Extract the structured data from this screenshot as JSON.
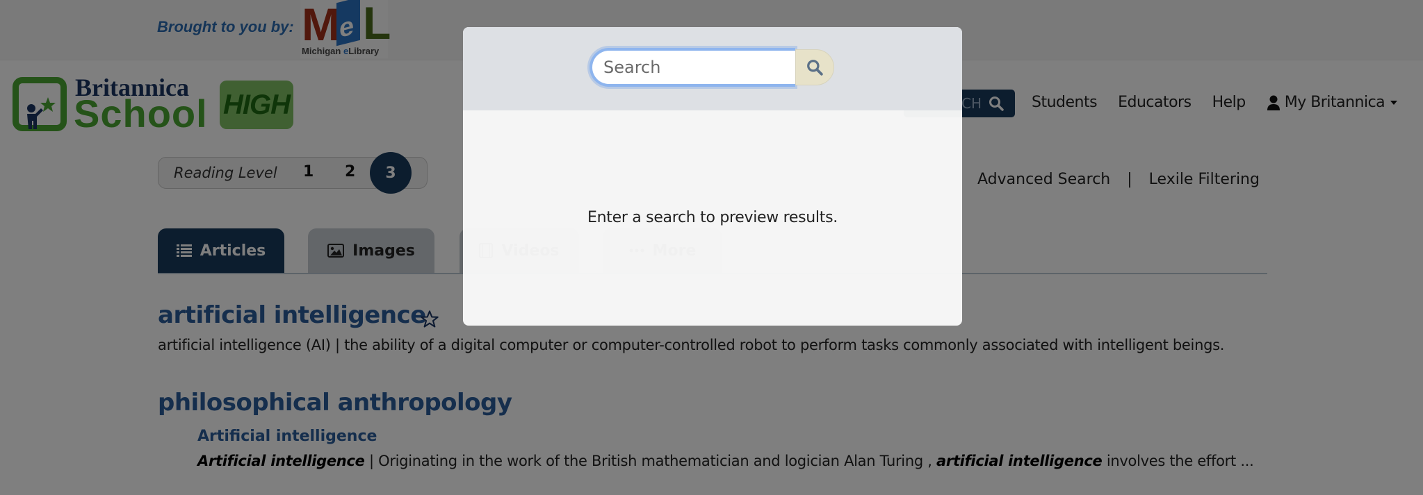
{
  "sponsor": {
    "label": "Brought to you by:",
    "logo": {
      "main": "MeL",
      "caption_prefix": "Michigan ",
      "caption_e": "e",
      "caption_suffix": "Library"
    }
  },
  "brand": {
    "line1": "Britannica",
    "line2": "School",
    "level_badge": "HIGH",
    "colors": {
      "green": "#4aa632",
      "navy": "#1a3563",
      "badge": "#80c064"
    }
  },
  "nav": {
    "search_button": "SEARCH",
    "links": [
      "Students",
      "Educators",
      "Help"
    ],
    "account": "My Britannica"
  },
  "reading_level": {
    "label": "Reading Level",
    "levels": [
      "1",
      "2",
      "3"
    ],
    "selected": "3"
  },
  "search_links": {
    "advanced": "Advanced Search",
    "separator": "|",
    "lexile": "Lexile Filtering"
  },
  "tabs": [
    {
      "label": "Articles",
      "icon": "list-icon",
      "active": true
    },
    {
      "label": "Images",
      "icon": "image-icon",
      "active": false
    },
    {
      "label": "Videos",
      "icon": "film-icon",
      "active": false
    },
    {
      "label": "More",
      "icon": "ellipsis-icon",
      "active": false
    }
  ],
  "results": [
    {
      "title": "artificial intelligence",
      "favorite_icon": "star-outline-icon",
      "snippet": "artificial intelligence (AI)  |   the ability of a digital computer  or computer-controlled robot  to perform tasks commonly associated with intelligent beings."
    },
    {
      "title": "philosophical anthropology",
      "subsection": "Artificial intelligence",
      "snippet_lead": "Artificial intelligence",
      "snippet_mid": "   | Originating in the work of the British mathematician and logician Alan Turing , ",
      "snippet_em": "artificial intelligence",
      "snippet_tail": " involves the effort ..."
    }
  ],
  "modal": {
    "search": {
      "value": "",
      "placeholder": "Search",
      "button_icon": "search-icon"
    },
    "message": "Enter a search to preview results."
  },
  "colors": {
    "primary_navy": "#193a5c",
    "link_blue": "#2b5c9a",
    "input_focus": "#8eb5ee",
    "search_button_bg": "#e7e2c9"
  }
}
